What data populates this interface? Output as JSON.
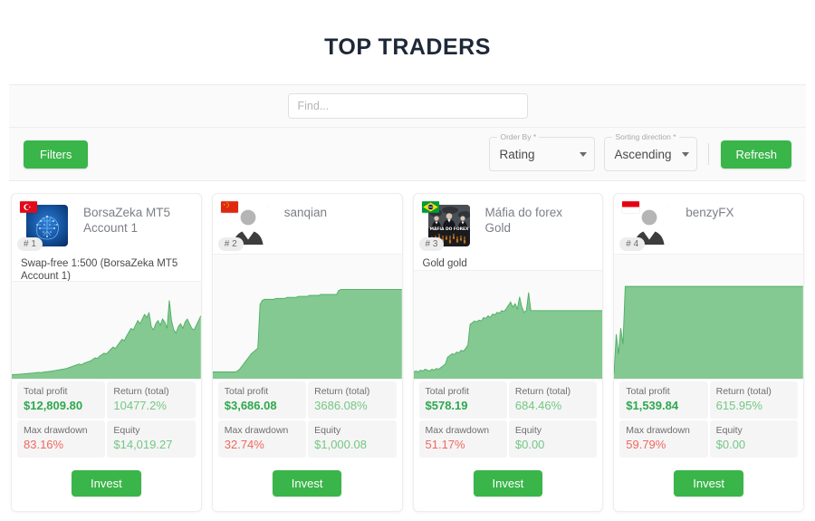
{
  "header": {
    "title": "TOP TRADERS"
  },
  "search": {
    "placeholder": "Find...",
    "value": ""
  },
  "toolbar": {
    "filters_label": "Filters",
    "refresh_label": "Refresh",
    "order_by": {
      "label": "Order By *",
      "value": "Rating"
    },
    "sorting_direction": {
      "label": "Sorting direction *",
      "value": "Ascending"
    }
  },
  "stat_labels": {
    "total_profit": "Total profit",
    "return_total": "Return (total)",
    "max_drawdown": "Max drawdown",
    "equity": "Equity"
  },
  "invest_label": "Invest",
  "colors": {
    "accent_green": "#3ab54a",
    "profit_green": "#2fa84f",
    "soft_green": "#74c785",
    "loss_red": "#f1685f",
    "chart_fill": "#7cc68b",
    "chart_stroke": "#4fae63",
    "title_navy": "#1d2838"
  },
  "cards": [
    {
      "rank": "# 1",
      "name": "BorsaZeka MT5 Account 1",
      "description": "Swap-free 1:500 (BorsaZeka MT5 Account 1)",
      "flag": "turkey-flag",
      "avatar": "circuit-brain-avatar",
      "total_profit": "$12,809.80",
      "return_total": "10477.2%",
      "max_drawdown": "83.16%",
      "equity": "$14,019.27",
      "chart": {
        "type": "area",
        "points": [
          0,
          0.5,
          0.6,
          0.8,
          1,
          1.2,
          1.5,
          1.8,
          2,
          2.2,
          2.5,
          3,
          3.2,
          3,
          3.5,
          4,
          4.2,
          4.5,
          5,
          5.5,
          6,
          6.5,
          7,
          7.5,
          8,
          9,
          10,
          11,
          12,
          13,
          14,
          13,
          15,
          16,
          17,
          18,
          20,
          22,
          21,
          24,
          26,
          28,
          27,
          30,
          33,
          36,
          34,
          38,
          42,
          46,
          44,
          50,
          55,
          60,
          58,
          64,
          70,
          66,
          72,
          78,
          74,
          80,
          62,
          58,
          66,
          70,
          64,
          72,
          68,
          60,
          96,
          70,
          58,
          54,
          62,
          66,
          60,
          68,
          72,
          66,
          60,
          58,
          64,
          70,
          76
        ]
      }
    },
    {
      "rank": "# 2",
      "name": "sanqian",
      "description": "",
      "flag": "china-flag",
      "avatar": "default-person-avatar",
      "total_profit": "$3,686.08",
      "return_total": "3686.08%",
      "max_drawdown": "32.74%",
      "equity": "$1,000.08",
      "chart": {
        "type": "area",
        "points": [
          2,
          2,
          2,
          2,
          2,
          2,
          2,
          2,
          2,
          2,
          2,
          3,
          5,
          8,
          11,
          14,
          17,
          20,
          22,
          24,
          26,
          70,
          74,
          75,
          75,
          75,
          75,
          75,
          76,
          76,
          76,
          76,
          76,
          77,
          77,
          77,
          77,
          77,
          78,
          78,
          78,
          78,
          78,
          79,
          79,
          79,
          79,
          79,
          80,
          80,
          80,
          80,
          80,
          80,
          80,
          80,
          84,
          85,
          85,
          85,
          85,
          85,
          85,
          85,
          85,
          85,
          85,
          85,
          85,
          85,
          85,
          85,
          85,
          85,
          85,
          85,
          85,
          85,
          85,
          85,
          85,
          85,
          85,
          85,
          85
        ]
      }
    },
    {
      "rank": "# 3",
      "name": "Máfia do forex Gold",
      "description": "Gold gold",
      "flag": "brazil-flag",
      "avatar": "mafia-do-forex-avatar",
      "total_profit": "$578.19",
      "return_total": "684.46%",
      "max_drawdown": "51.17%",
      "equity": "$0.00",
      "chart": {
        "type": "area",
        "points": [
          3,
          4,
          3,
          5,
          4,
          6,
          5,
          4,
          6,
          5,
          7,
          6,
          8,
          10,
          12,
          20,
          22,
          24,
          23,
          26,
          25,
          28,
          27,
          30,
          34,
          58,
          60,
          62,
          61,
          63,
          62,
          66,
          65,
          68,
          66,
          70,
          69,
          72,
          71,
          74,
          73,
          76,
          80,
          84,
          78,
          82,
          76,
          90,
          78,
          72,
          74,
          95,
          74,
          74,
          74,
          74,
          74,
          74,
          74,
          74,
          74,
          74,
          74,
          74,
          74,
          74,
          74,
          74,
          74,
          74,
          74,
          74,
          74,
          74,
          74,
          74,
          74,
          74,
          74,
          74,
          74,
          74,
          74,
          74,
          74
        ]
      }
    },
    {
      "rank": "# 4",
      "name": "benzyFX",
      "description": "",
      "flag": "indonesia-flag",
      "avatar": "default-person-avatar",
      "total_profit": "$1,539.84",
      "return_total": "615.95%",
      "max_drawdown": "59.79%",
      "equity": "$0.00",
      "chart": {
        "type": "area",
        "points": [
          0,
          40,
          20,
          46,
          30,
          88,
          88,
          88,
          88,
          88,
          88,
          88,
          88,
          88,
          88,
          88,
          88,
          88,
          88,
          88,
          88,
          88,
          88,
          88,
          88,
          88,
          88,
          88,
          88,
          88,
          88,
          88,
          88,
          88,
          88,
          88,
          88,
          88,
          88,
          88,
          88,
          88,
          88,
          88,
          88,
          88,
          88,
          88,
          88,
          88,
          88,
          88,
          88,
          88,
          88,
          88,
          88,
          88,
          88,
          88,
          88,
          88,
          88,
          88,
          88,
          88,
          88,
          88,
          88,
          88,
          88,
          88,
          88,
          88,
          88,
          88,
          88,
          88,
          88,
          88,
          88,
          88,
          88,
          88,
          88
        ]
      }
    }
  ]
}
